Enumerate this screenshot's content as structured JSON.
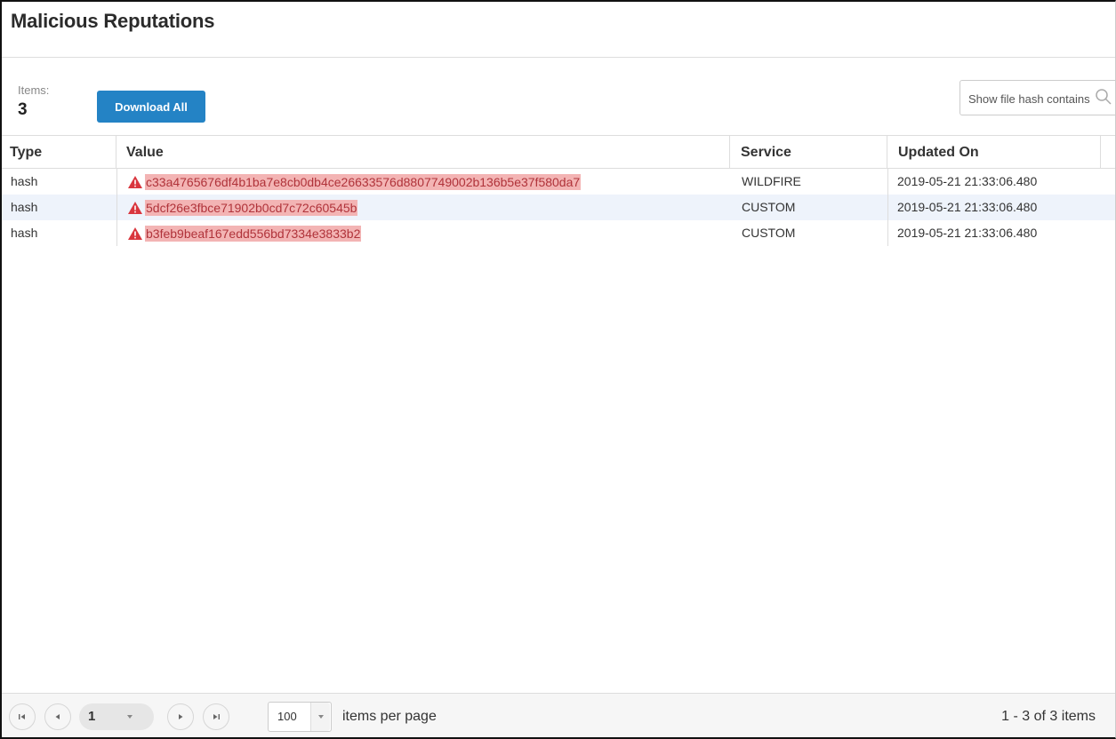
{
  "title": "Malicious Reputations",
  "items": {
    "label": "Items:",
    "count": "3"
  },
  "download_button": "Download All",
  "search": {
    "placeholder": "Show file hash contains",
    "icon": "search-icon"
  },
  "columns": [
    "Type",
    "Value",
    "Service",
    "Updated On"
  ],
  "rows": [
    {
      "type": "hash",
      "value": "c33a4765676df4b1ba7e8cb0db4ce26633576d8807749002b136b5e37f580da7",
      "service": "WILDFIRE",
      "updated": "2019-05-21 21:33:06.480"
    },
    {
      "type": "hash",
      "value": "5dcf26e3fbce71902b0cd7c72c60545b",
      "service": "CUSTOM",
      "updated": "2019-05-21 21:33:06.480"
    },
    {
      "type": "hash",
      "value": "b3feb9beaf167edd556bd7334e3833b2",
      "service": "CUSTOM",
      "updated": "2019-05-21 21:33:06.480"
    }
  ],
  "pager": {
    "current_page": "1",
    "page_size": "100",
    "per_page_label": "items per page",
    "range": "1 - 3 of 3 items"
  },
  "colors": {
    "accent": "#2483c5",
    "hash_highlight": "#f3b4b4",
    "warning": "#d9363e",
    "selected_row": "#eef3fb"
  }
}
